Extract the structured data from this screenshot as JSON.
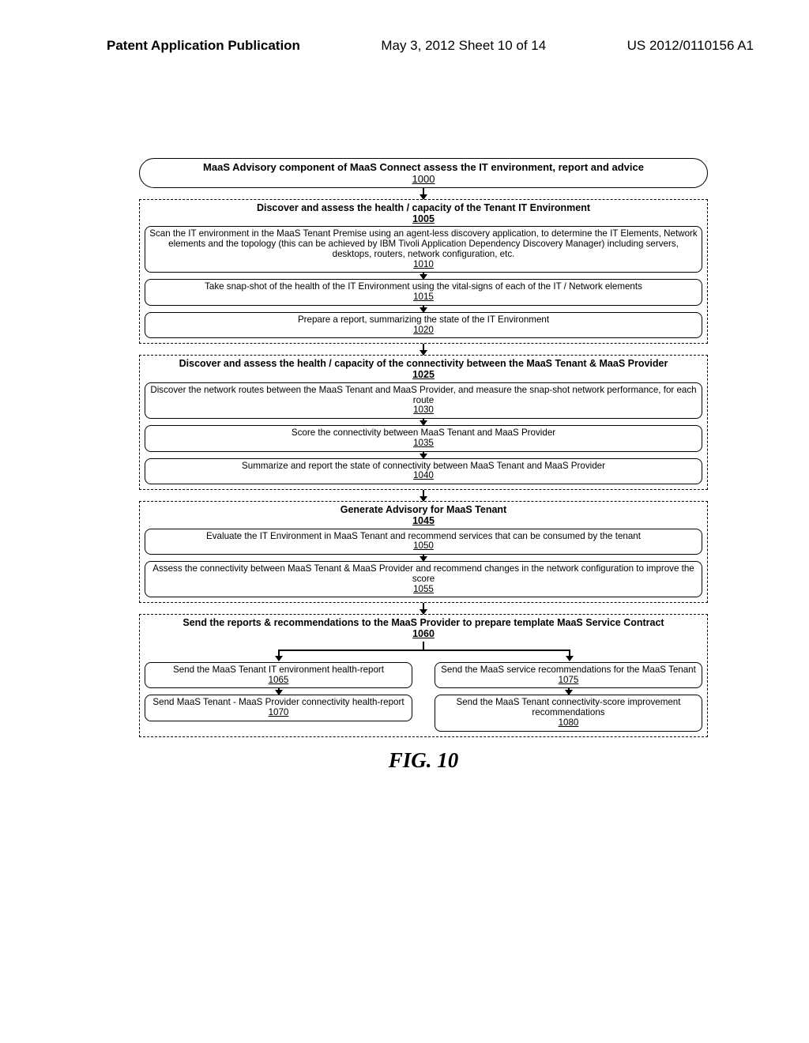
{
  "header": {
    "left": "Patent Application Publication",
    "center": "May 3, 2012  Sheet 10 of 14",
    "right": "US 2012/0110156 A1"
  },
  "title": {
    "line": "MaaS Advisory component of MaaS Connect assess the IT environment, report and advice",
    "ref": "1000"
  },
  "g1": {
    "title": "Discover and assess the health / capacity of the Tenant IT Environment",
    "title_ref": "1005",
    "b1": "Scan the IT environment in the MaaS Tenant Premise using an agent-less discovery application, to determine the IT Elements, Network elements and the topology (this can be achieved by IBM Tivoli Application Dependency Discovery Manager) including servers, desktops, routers, network configuration, etc.",
    "b1_ref": "1010",
    "b2": "Take snap-shot of the health of the IT Environment using the vital-signs of each of the IT / Network elements",
    "b2_ref": "1015",
    "b3": "Prepare a report, summarizing the state of the IT Environment",
    "b3_ref": "1020"
  },
  "g2": {
    "title": "Discover and assess the health / capacity of the connectivity between the MaaS Tenant & MaaS Provider",
    "title_ref": "1025",
    "b1": "Discover the network routes between the MaaS Tenant and MaaS Provider, and measure the snap-shot network performance, for each route",
    "b1_ref": "1030",
    "b2": "Score the connectivity between MaaS Tenant and MaaS Provider",
    "b2_ref": "1035",
    "b3": "Summarize and report the state of connectivity between MaaS Tenant and MaaS Provider",
    "b3_ref": "1040"
  },
  "g3": {
    "title": "Generate Advisory for MaaS Tenant",
    "title_ref": "1045",
    "b1": "Evaluate the IT Environment in MaaS Tenant and recommend services that can be consumed by the tenant",
    "b1_ref": "1050",
    "b2": "Assess the connectivity between MaaS Tenant & MaaS Provider and recommend changes in the network configuration to improve the score",
    "b2_ref": "1055"
  },
  "g4": {
    "title": "Send the reports & recommendations to the MaaS Provider to prepare template MaaS Service Contract",
    "title_ref": "1060",
    "l1": "Send the MaaS Tenant IT environment health-report",
    "l1_ref": "1065",
    "l2": "Send MaaS Tenant - MaaS Provider connectivity health-report",
    "l2_ref": "1070",
    "r1": "Send the MaaS service recommendations for the MaaS Tenant",
    "r1_ref": "1075",
    "r2": "Send the MaaS Tenant connectivity-score improvement recommendations",
    "r2_ref": "1080"
  },
  "figure": "FIG. 10"
}
